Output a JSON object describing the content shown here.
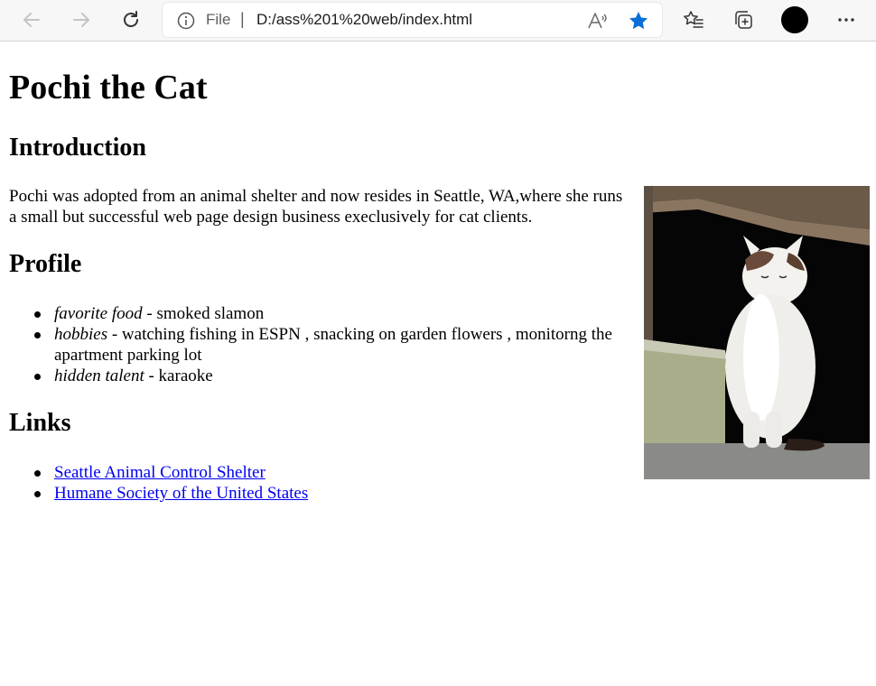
{
  "browser": {
    "address": {
      "scheme_label": "File",
      "separator": "|",
      "url": "D:/ass%201%20web/index.html"
    },
    "icons": [
      "back-icon",
      "forward-icon",
      "refresh-icon",
      "info-icon",
      "read-aloud-icon",
      "favorite-star-icon",
      "favorites-icon",
      "collections-icon",
      "profile-avatar",
      "more-icon"
    ],
    "accent": "#0a6fd6"
  },
  "page": {
    "title": "Pochi the Cat",
    "intro": {
      "heading": "Introduction",
      "text": "Pochi was adopted from an animal shelter and now resides in Seattle, WA,where she runs a small but successful web page design business execlusively for cat clients."
    },
    "profile": {
      "heading": "Profile",
      "items": [
        {
          "term": "favorite food",
          "desc": " - smoked slamon"
        },
        {
          "term": "hobbies",
          "desc": " - watching fishing in ESPN , snacking on garden flowers , monitorng the apartment parking lot"
        },
        {
          "term": "hidden talent",
          "desc": " - karaoke"
        }
      ]
    },
    "links": {
      "heading": "Links",
      "items": [
        {
          "label": "Seattle Animal Control Shelter"
        },
        {
          "label": "Humane Society of the United States"
        }
      ]
    },
    "image": {
      "subject": "white cat with brown ear patches sitting near a stone step"
    }
  }
}
